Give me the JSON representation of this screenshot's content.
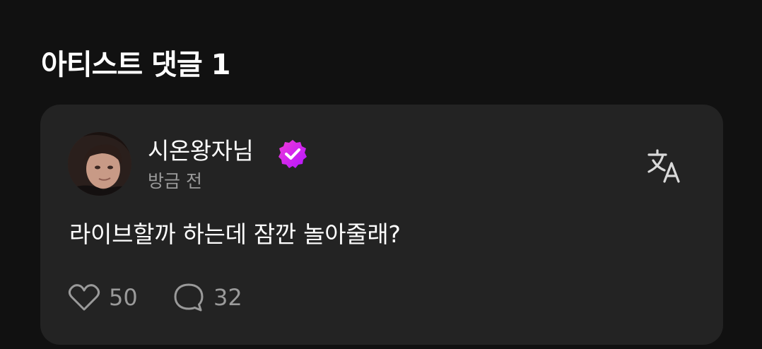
{
  "section": {
    "title": "아티스트 댓글 1"
  },
  "comment": {
    "author": "시온왕자님",
    "verified_color": "#D81FE8",
    "timestamp": "방금 전",
    "text": "라이브할까 하는데 잠깐 놀아줄래?",
    "likes": "50",
    "replies": "32",
    "icons": {
      "avatar": "avatar-photo",
      "verified": "verified-badge-icon",
      "translate": "translate-icon",
      "like": "heart-icon",
      "reply": "speech-bubble-icon"
    }
  },
  "colors": {
    "background": "#111111",
    "card": "#232323",
    "secondary_text": "#9a9a9a"
  }
}
